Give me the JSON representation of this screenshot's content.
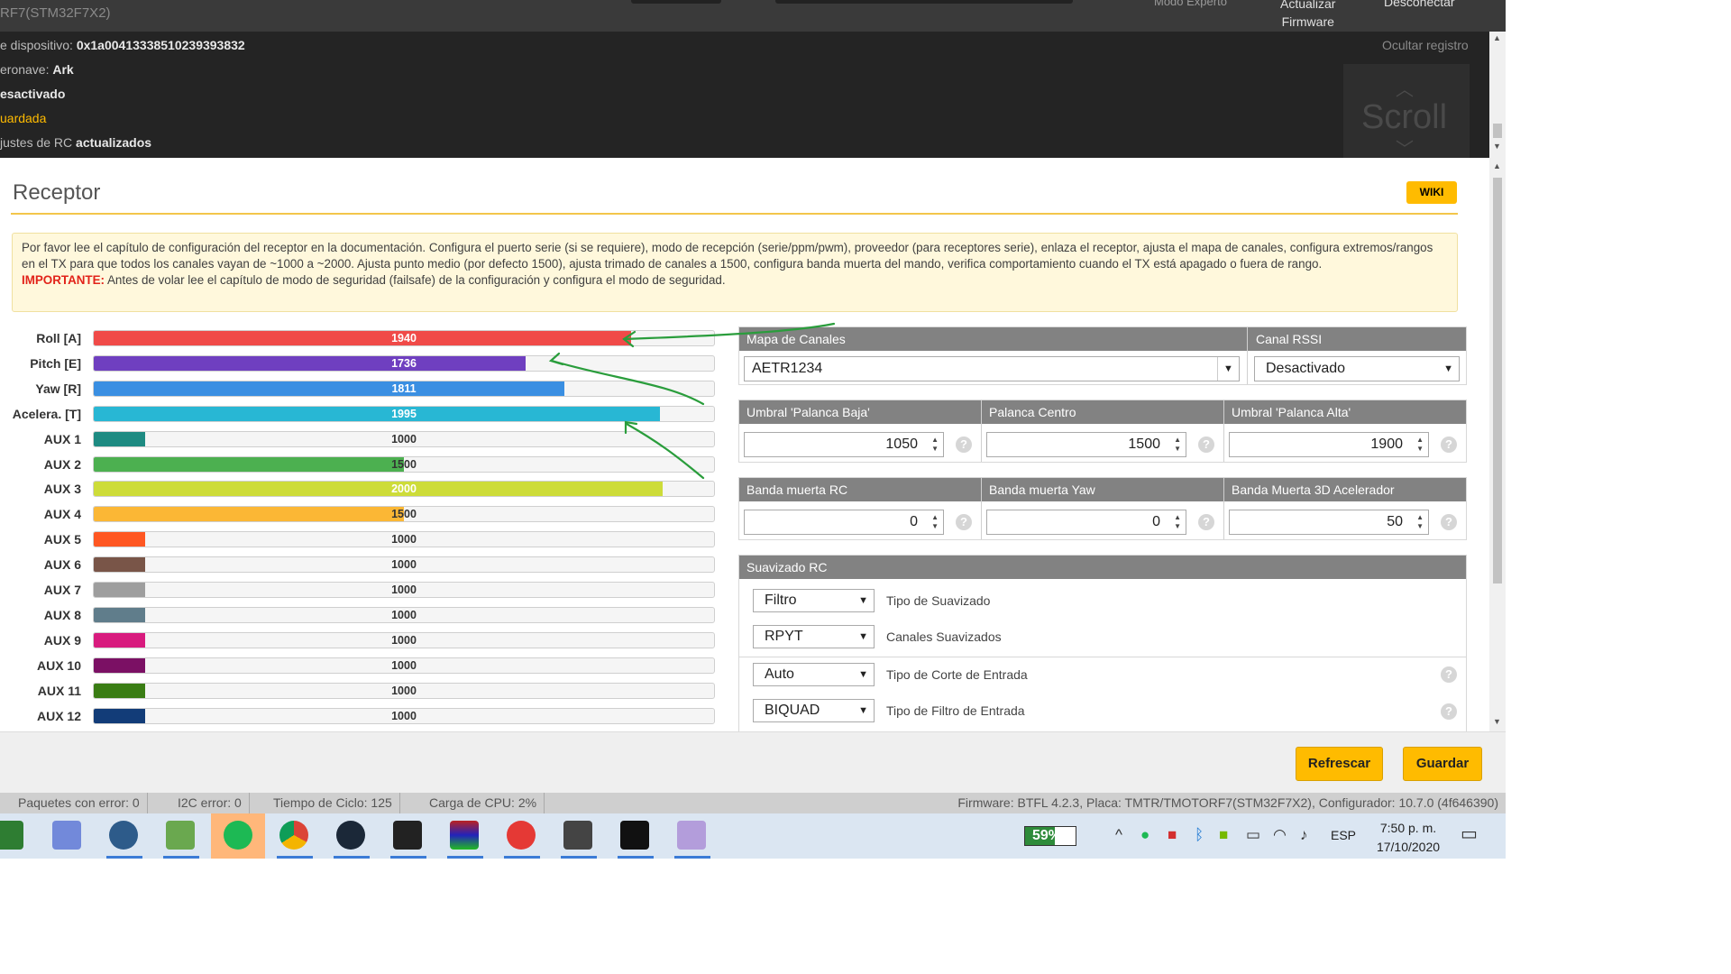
{
  "top": {
    "title": "RF7(STM32F7X2)",
    "mode_label": "Modo Experto",
    "update_label_1": "Actualizar",
    "update_label_2": "Firmware",
    "disconnect_label": "Desconectar"
  },
  "log": {
    "lines": [
      {
        "prefix": "e dispositivo: ",
        "bold": "0x1a00413338510239393832",
        "color": "#bcbcbc"
      },
      {
        "prefix": "eronave: ",
        "bold": "Ark",
        "color": "#bcbcbc"
      },
      {
        "prefix": "",
        "bold": "esactivado",
        "color": "#bcbcbc"
      },
      {
        "prefix": "uardada",
        "bold": "",
        "color": "#ffbb00"
      },
      {
        "prefix": "justes de RC ",
        "bold": "actualizados",
        "color": "#bcbcbc"
      }
    ],
    "hide_label": "Ocultar registro",
    "scroll_label": "Scroll"
  },
  "page": {
    "title": "Receptor",
    "wiki_label": "WIKI",
    "note_text": "Por favor lee el capítulo de configuración del receptor en la documentación. Configura el puerto serie (si se requiere), modo de recepción (serie/ppm/pwm), proveedor (para receptores serie), enlaza el receptor, ajusta el mapa de canales, configura extremos/rangos en el TX para que todos los canales vayan de ~1000 a ~2000. Ajusta punto medio (por defecto 1500), ajusta trimado de canales a 1500, configura banda muerta del mando, verifica comportamiento cuando el TX está apagado o fuera de rango.",
    "note_important_label": "IMPORTANTE:",
    "note_important_text": " Antes de volar lee el capítulo de modo de seguridad (failsafe) de la configuración y configura el modo de seguridad."
  },
  "channels": [
    {
      "label": "Roll [A]",
      "value": 1940,
      "color": "#f04a48"
    },
    {
      "label": "Pitch [E]",
      "value": 1736,
      "color": "#6f3fc0"
    },
    {
      "label": "Yaw [R]",
      "value": 1811,
      "color": "#3a8fe2"
    },
    {
      "label": "Acelera. [T]",
      "value": 1995,
      "color": "#28b7d4"
    },
    {
      "label": "AUX 1",
      "value": 1000,
      "color": "#1e8b82"
    },
    {
      "label": "AUX 2",
      "value": 1500,
      "color": "#4cb050"
    },
    {
      "label": "AUX 3",
      "value": 2000,
      "color": "#cddc39"
    },
    {
      "label": "AUX 4",
      "value": 1500,
      "color": "#fbb735"
    },
    {
      "label": "AUX 5",
      "value": 1000,
      "color": "#ff5722"
    },
    {
      "label": "AUX 6",
      "value": 1000,
      "color": "#795548"
    },
    {
      "label": "AUX 7",
      "value": 1000,
      "color": "#9e9e9e"
    },
    {
      "label": "AUX 8",
      "value": 1000,
      "color": "#607d8b"
    },
    {
      "label": "AUX 9",
      "value": 1000,
      "color": "#d81b7e"
    },
    {
      "label": "AUX 10",
      "value": 1000,
      "color": "#7b1064"
    },
    {
      "label": "AUX 11",
      "value": 1000,
      "color": "#3a7d14"
    },
    {
      "label": "AUX 12",
      "value": 1000,
      "color": "#123c78"
    }
  ],
  "config": {
    "channel_map_label": "Mapa de Canales",
    "channel_map_value": "AETR1234",
    "rssi_label": "Canal RSSI",
    "rssi_value": "Desactivado",
    "stick_low_label": "Umbral 'Palanca Baja'",
    "stick_low_value": "1050",
    "stick_center_label": "Palanca Centro",
    "stick_center_value": "1500",
    "stick_high_label": "Umbral 'Palanca Alta'",
    "stick_high_value": "1900",
    "deadband_label": "Banda muerta RC",
    "deadband_value": "0",
    "yaw_deadband_label": "Banda muerta Yaw",
    "yaw_deadband_value": "0",
    "throttle_3d_label": "Banda Muerta 3D Acelerador",
    "throttle_3d_value": "50",
    "smoothing_title": "Suavizado RC",
    "smoothing_type_value": "Filtro",
    "smoothing_type_label": "Tipo de Suavizado",
    "smoothed_channels_value": "RPYT",
    "smoothed_channels_label": "Canales Suavizados",
    "input_cutoff_value": "Auto",
    "input_cutoff_label": "Tipo de Corte de Entrada",
    "input_filter_value": "BIQUAD",
    "input_filter_label": "Tipo de Filtro de Entrada",
    "help_glyph": "?"
  },
  "toolbar": {
    "refresh_label": "Refrescar",
    "save_label": "Guardar"
  },
  "status": {
    "packet_errors": "Paquetes con error: 0",
    "i2c_errors": "I2C error: 0",
    "cycle_time": "Tiempo de Ciclo: 125",
    "cpu_load": "Carga de CPU: 2%",
    "firmware": "Firmware: BTFL 4.2.3, Placa: TMTR/TMOTORF7(STM32F7X2), Configurador: 10.7.0 (4f646390)"
  },
  "taskbar": {
    "battery_level": 0.59,
    "battery_label": "59%",
    "language": "ESP",
    "time": "7:50 p. m.",
    "date": "17/10/2020"
  }
}
